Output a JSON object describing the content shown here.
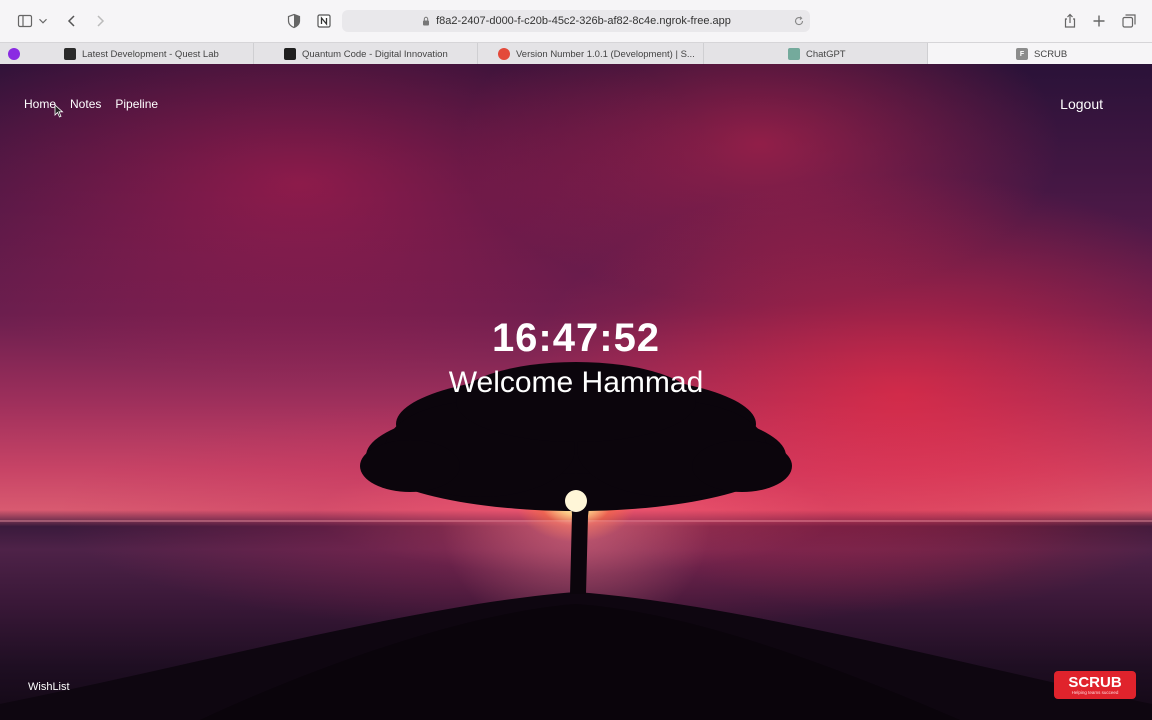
{
  "browser": {
    "url": "f8a2-2407-d000-f-c20b-45c2-326b-af82-8c4e.ngrok-free.app",
    "tabs": [
      {
        "label": "Latest Development - Quest Lab",
        "favicon_color": "#2b2b2b"
      },
      {
        "label": "Quantum Code - Digital Innovation",
        "favicon_color": "#1f1f1f"
      },
      {
        "label": "Version Number 1.0.1 (Development) | S...",
        "favicon_color": "#e34a3b"
      },
      {
        "label": "ChatGPT",
        "favicon_color": "#74aa9c"
      },
      {
        "label": "SCRUB",
        "favicon_color": "#8c8c8c",
        "favicon_letter": "F"
      }
    ]
  },
  "nav": {
    "home": "Home",
    "notes": "Notes",
    "pipeline": "Pipeline",
    "logout": "Logout"
  },
  "clock": {
    "time": "16:47:52",
    "welcome": "Welcome Hammad"
  },
  "footer": {
    "wishlist": "WishList"
  },
  "badge": {
    "name": "SCRUB",
    "tagline": "Helping teams succeed",
    "color": "#e0232c"
  }
}
